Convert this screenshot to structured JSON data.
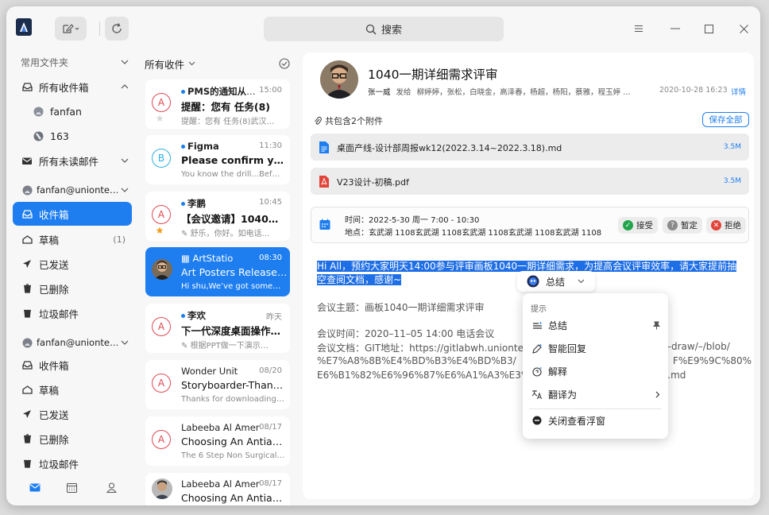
{
  "search": {
    "label": "搜索"
  },
  "sidebar": {
    "common_folders": "常用文件夹",
    "all_inbox": "所有收件箱",
    "accounts_short": [
      "fanfan",
      "163"
    ],
    "all_unread": "所有未读邮件",
    "account1": "fanfan@unionte…",
    "account2": "fanfan@unionte…",
    "inbox": "收件箱",
    "drafts": "草稿",
    "drafts_count": "(1)",
    "sent": "已发送",
    "deleted": "已删除",
    "junk": "垃圾邮件"
  },
  "list": {
    "header": "所有收件",
    "items": [
      {
        "avatar": "A",
        "from": "PMS的通知从1…",
        "time": "15:00",
        "subject": "提醒：您有 任务(8)",
        "preview": "提醒：您有 任务(8)武汉…",
        "unread": true,
        "bold": true
      },
      {
        "avatar": "B",
        "from": "Figma",
        "time": "11:30",
        "subject": "Please confirm you…",
        "preview": "You know the drill...Bef…",
        "unread": true,
        "bold": true
      },
      {
        "avatar": "A",
        "from": "李鹏",
        "time": "10:45",
        "subject": "【会议邀请】1040一…",
        "preview": "舒乐，你好。如电话…",
        "unread": true,
        "bold": true
      },
      {
        "from": "ArtStatio",
        "time": "08:30",
        "subject": "Art Posters Released …",
        "preview": "Hi shu,We’ve got some…"
      },
      {
        "avatar": "A",
        "from": "李欢",
        "time": "昨天",
        "subject": "下一代深度桌面操作…",
        "preview": "根据PPT做一下演示…",
        "unread": true,
        "bold": true
      },
      {
        "avatar": "A",
        "from": "Wonder Unit",
        "time": "08/20",
        "subject": "Storyboarder-Than…",
        "preview": "Thanks for downloading…"
      },
      {
        "avatar": "A",
        "from": "Labeeba Al Amer",
        "time": "08/17",
        "subject": "Choosing An Antiagi…",
        "preview": "The 6 Step Non Surgical …"
      },
      {
        "from": "Labeeba Al Amer",
        "time": "08/17",
        "subject": "Choosing An Antiaging",
        "preview": ""
      }
    ]
  },
  "mail": {
    "title": "1040一期详细需求评审",
    "sender": "张一威",
    "sent_word": "发给",
    "recipients": "柳婷婷，张松，白晓金，高泽春，杨超，杨阳，蔡雅，程玉婷 …",
    "date": "2020-10-28 16:23",
    "detail": "详情",
    "attachments_label": "共包含2个附件",
    "save_all": "保存全部",
    "attachments": [
      {
        "name": "桌面产线-设计部周报wk12(2022.3.14~2022.3.18).md",
        "size": "3.5M"
      },
      {
        "name": "V23设计-初稿.pdf",
        "size": "3.5M"
      }
    ],
    "calendar": {
      "time": "时间：2022-5-30 周一 7:00 - 10:30",
      "place": "地点：玄武湖 1108玄武湖 1108玄武湖 1108玄武湖 1108玄武湖 1108",
      "accept": "接受",
      "tentative": "暂定",
      "decline": "拒绝"
    },
    "body": {
      "hl_line1": "Hi All，预约大家明天14:00参与评审画板1040一期详细需求，为提高会议评审效率，请大家提前抽",
      "hl_line2": "空查阅文档，感谢~",
      "topic": "会议主题：画板1040一期详细需求评审",
      "time": "会议时间：2020–11–05 14:00  电话会议",
      "doc_a": "会议文档：GIT地址：https://gitlabwh.unionte",
      "doc_a_r": "–draw/–/blob/",
      "doc_b": "%E7%A8%8B%E4%BD%B3%E4%BD%B3/",
      "doc_b_r": "F%E9%9C%80%",
      "doc_c": "E6%B1%82%E6%96%87%E6%A1%A3%E3%",
      "doc_c_r": "91.md"
    }
  },
  "ai": {
    "button": "总结",
    "hint": "提示",
    "items": [
      "总结",
      "智能回复",
      "解释",
      "翻译为"
    ],
    "close": "关闭查看浮窗"
  },
  "colors": {
    "accent": "#1e7ef0",
    "selection": "#1e6ee6",
    "accept": "#21a44a",
    "decline": "#e2443a",
    "tentative": "#8a8a8a",
    "pdf": "#e2443a",
    "md": "#1e7ef0"
  }
}
